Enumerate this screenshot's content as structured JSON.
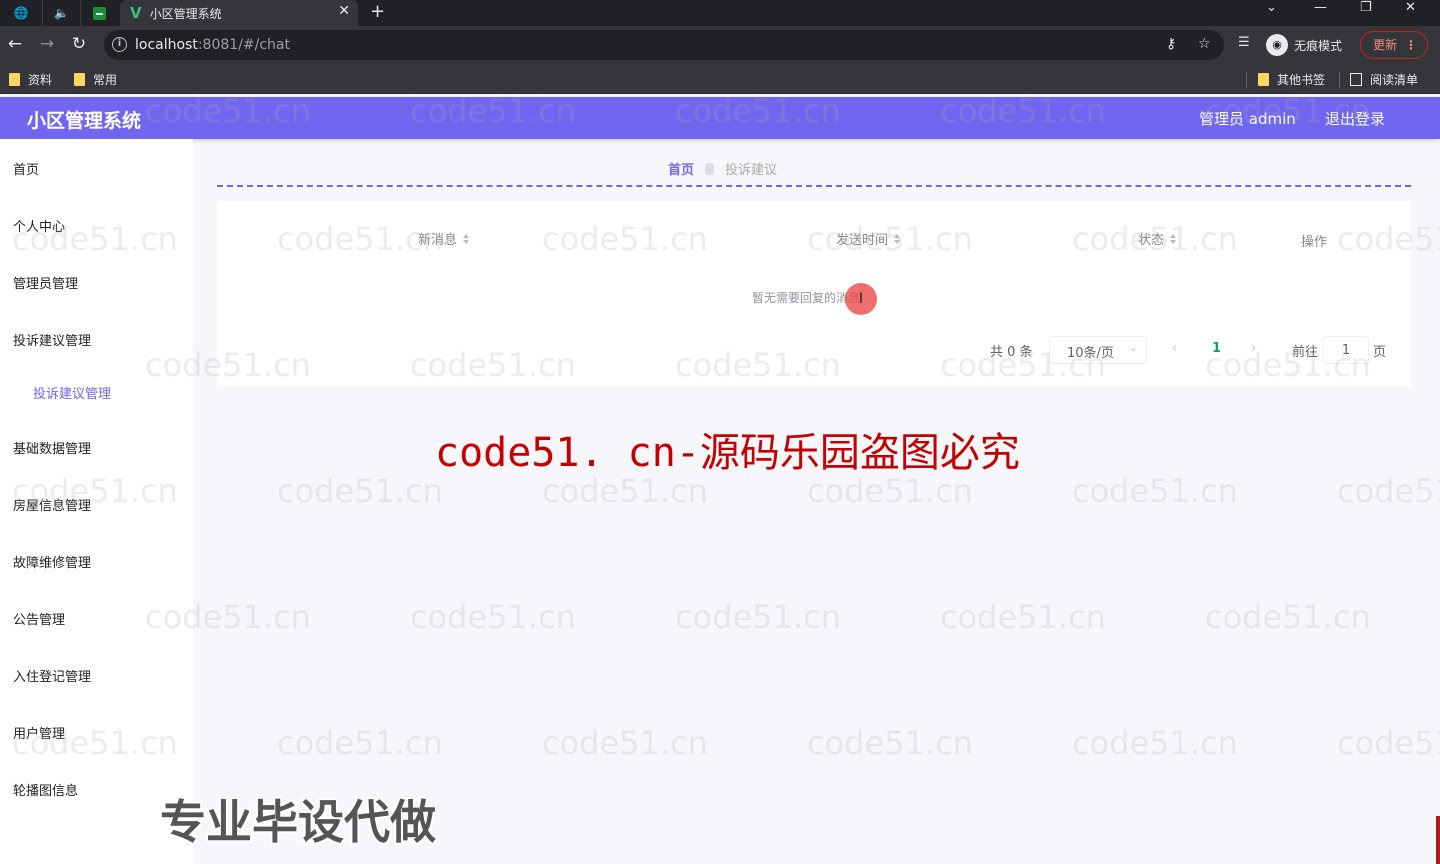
{
  "browser": {
    "tab_title": "小区管理系统",
    "url_host": "localhost",
    "url_rest": ":8081/#/chat",
    "incognito_label": "无痕模式",
    "update_label": "更新",
    "bookmarks": [
      "资料",
      "常用"
    ],
    "other_bookmarks": "其他书签",
    "reading_list": "阅读清单"
  },
  "header": {
    "title": "小区管理系统",
    "user_label": "管理员 admin",
    "logout_label": "退出登录"
  },
  "sidebar": {
    "items": [
      {
        "label": "首页"
      },
      {
        "label": "个人中心"
      },
      {
        "label": "管理员管理"
      },
      {
        "label": "投诉建议管理"
      },
      {
        "label": "投诉建议管理",
        "sub": true,
        "active": true
      },
      {
        "label": "基础数据管理"
      },
      {
        "label": "房屋信息管理"
      },
      {
        "label": "故障维修管理"
      },
      {
        "label": "公告管理"
      },
      {
        "label": "入住登记管理"
      },
      {
        "label": "用户管理"
      },
      {
        "label": "轮播图信息"
      }
    ]
  },
  "breadcrumb": {
    "home": "首页",
    "current": "投诉建议"
  },
  "table": {
    "columns": [
      "新消息",
      "发送时间",
      "状态",
      "操作"
    ],
    "empty_text": "暂无需要回复的消息"
  },
  "pagination": {
    "total_label": "共 0 条",
    "page_size": "10条/页",
    "current_page": "1",
    "goto_label": "前往",
    "goto_value": "1",
    "page_suffix": "页"
  },
  "watermarks": {
    "tile": "code51.cn",
    "banner": "code51. cn-源码乐园盗图必究",
    "promo": "专业毕设代做"
  },
  "colors": {
    "brand": "#7166f0",
    "active_page": "#1e9a6a",
    "watermark_red": "#c40000"
  }
}
